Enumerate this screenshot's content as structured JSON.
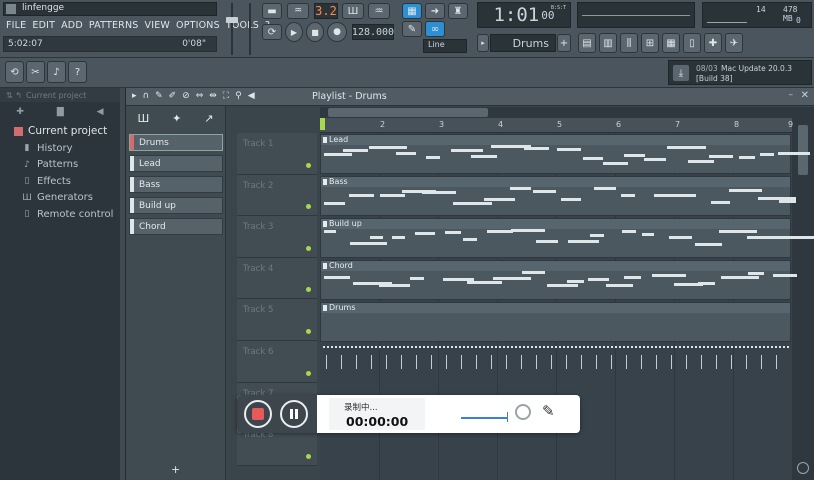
{
  "app": {
    "title": "linfengge",
    "menu": [
      "FILE",
      "EDIT",
      "ADD",
      "PATTERNS",
      "VIEW",
      "OPTIONS",
      "TOOLS",
      "?"
    ],
    "hint_time": "5:02:07",
    "hint_right": "0'08\""
  },
  "transport": {
    "pattern_num": "3.2",
    "tempo": "128.000",
    "time": "1:01",
    "time_small": "00",
    "bst": "B:S:T",
    "snap": "Line",
    "pattern_name": "Drums"
  },
  "cpu": {
    "poly": "14",
    "ram": "478 MB",
    "ram_sub": "0"
  },
  "news": {
    "date": "08/03",
    "title": "Mac Update 20.0.3",
    "build": "[Build 38]"
  },
  "browser": {
    "header": "Current project",
    "root": "Current project",
    "items": [
      {
        "label": "History",
        "icon": "history-icon"
      },
      {
        "label": "Patterns",
        "icon": "patterns-icon"
      },
      {
        "label": "Effects",
        "icon": "effects-icon"
      },
      {
        "label": "Generators",
        "icon": "generators-icon"
      },
      {
        "label": "Remote control",
        "icon": "remote-control-icon"
      }
    ]
  },
  "playlist": {
    "title": "Playlist - Drums",
    "patterns": [
      "Drums",
      "Lead",
      "Bass",
      "Build up",
      "Chord"
    ],
    "tracks": [
      "Track 1",
      "Track 2",
      "Track 3",
      "Track 4",
      "Track 5",
      "Track 6",
      "Track 7",
      "Track 8"
    ],
    "bars": [
      "2",
      "3",
      "4",
      "5",
      "6",
      "7",
      "8",
      "9"
    ],
    "clips": [
      "Lead",
      "Bass",
      "Build up",
      "Chord",
      "Drums"
    ]
  },
  "recorder": {
    "status": "录制中...",
    "time": "00:00:00"
  }
}
